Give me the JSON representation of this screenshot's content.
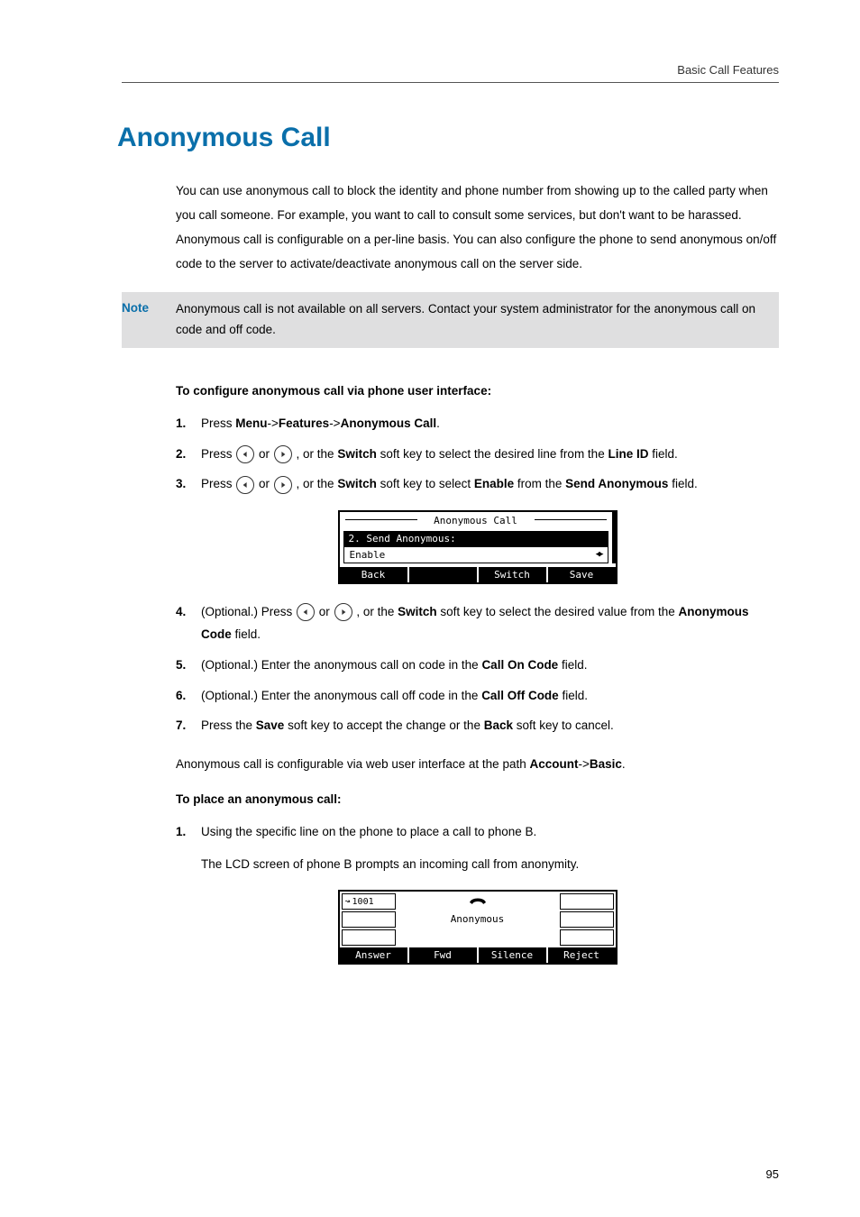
{
  "header": {
    "section": "Basic Call Features"
  },
  "title": "Anonymous Call",
  "intro": "You can use anonymous call to block the identity and phone number from showing up to the called party when you call someone. For example, you want to call to consult some services, but don't want to be harassed. Anonymous call is configurable on a per-line basis. You can also configure the phone to send anonymous on/off code to the server to activate/deactivate anonymous call on the server side.",
  "note": {
    "label": "Note",
    "text": "Anonymous call is not available on all servers. Contact your system administrator for the anonymous call on code and off code."
  },
  "configure_heading": "To configure anonymous call via phone user interface:",
  "steps1": {
    "s1_a": "Press ",
    "s1_b": "Menu",
    "s1_c": "->",
    "s1_d": "Features",
    "s1_e": "->",
    "s1_f": "Anonymous Call",
    "s1_g": ".",
    "s2_a": "Press ",
    "s2_b": " or ",
    "s2_c": " , or the ",
    "s2_d": "Switch",
    "s2_e": " soft key to select the desired line from the ",
    "s2_f": "Line ID",
    "s2_g": " field.",
    "s3_a": "Press ",
    "s3_b": " or ",
    "s3_c": " , or the ",
    "s3_d": "Switch",
    "s3_e": " soft key to select ",
    "s3_f": "Enable",
    "s3_g": " from the ",
    "s3_h": "Send Anonymous",
    "s3_i": " field."
  },
  "lcd1": {
    "title": "Anonymous Call",
    "field_label": "2. Send Anonymous:",
    "field_value": "Enable",
    "softkeys": [
      "Back",
      "",
      "Switch",
      "Save"
    ]
  },
  "steps2": {
    "s4_a": "(Optional.) Press ",
    "s4_b": " or ",
    "s4_c": " , or the ",
    "s4_d": "Switch",
    "s4_e": " soft key to select the desired value from the ",
    "s4_f": "Anonymous Code",
    "s4_g": " field.",
    "s5_a": "(Optional.) Enter the anonymous call on code in the ",
    "s5_b": "Call On Code",
    "s5_c": " field.",
    "s6_a": "(Optional.) Enter the anonymous call off code in the ",
    "s6_b": "Call Off Code",
    "s6_c": " field.",
    "s7_a": "Press the ",
    "s7_b": "Save",
    "s7_c": " soft key to accept the change or the ",
    "s7_d": "Back",
    "s7_e": " soft key to cancel."
  },
  "web_path": {
    "a": "Anonymous call is configurable via web user interface at the path ",
    "b": "Account",
    "c": "->",
    "d": "Basic",
    "e": "."
  },
  "place_heading": "To place an anonymous call:",
  "place_steps": {
    "s1": "Using the specific line on the phone to place a call to phone B.",
    "s1_sub": "The LCD screen of phone B prompts an incoming call from anonymity."
  },
  "lcd2": {
    "line": "1001",
    "caller": "Anonymous",
    "softkeys": [
      "Answer",
      "Fwd",
      "Silence",
      "Reject"
    ]
  },
  "page_number": "95"
}
